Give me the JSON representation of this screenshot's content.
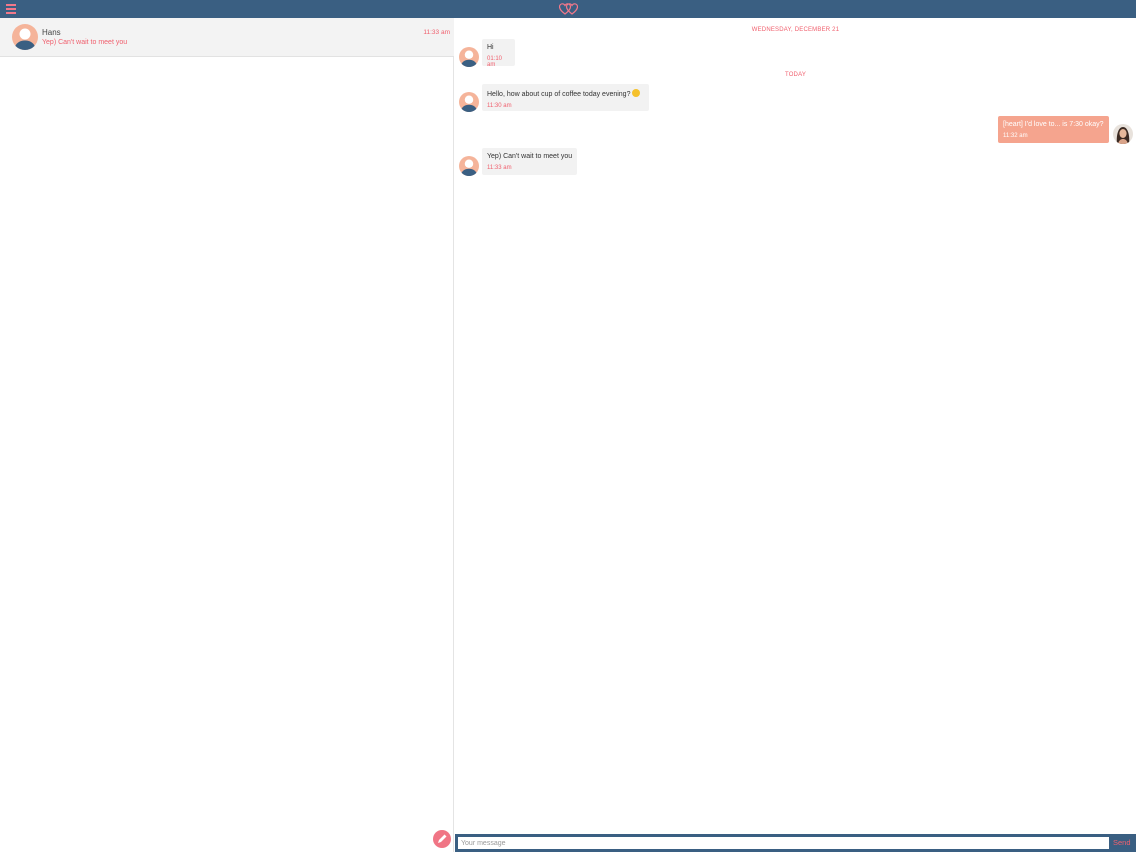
{
  "header": {
    "menu_icon": "hamburger-menu-icon",
    "logo_icon": "hearts-logo-icon"
  },
  "sidebar": {
    "conversations": [
      {
        "name": "Hans",
        "preview": "Yep) Can't wait to meet you",
        "time": "11:33 am"
      }
    ]
  },
  "chat": {
    "separators": [
      "WEDNESDAY, DECEMBER 21",
      "TODAY"
    ],
    "messages": [
      {
        "direction": "in",
        "text": "Hi",
        "time": "01:10 am"
      },
      {
        "direction": "in",
        "text": "Hello, how about cup of coffee today evening?",
        "time": "11:30 am",
        "emoji": "smile-emoji"
      },
      {
        "direction": "out",
        "text": "[heart] I'd love to... is 7:30 okay?",
        "time": "11:32 am"
      },
      {
        "direction": "in",
        "text": "Yep) Can't wait to meet you",
        "time": "11:33 am"
      }
    ]
  },
  "composer": {
    "placeholder": "Your message",
    "send_label": "Send"
  },
  "colors": {
    "header": "#3a5f82",
    "accent": "#f0606e",
    "outgoing_bubble": "#f5a48e",
    "incoming_bubble": "#f2f2f2"
  }
}
